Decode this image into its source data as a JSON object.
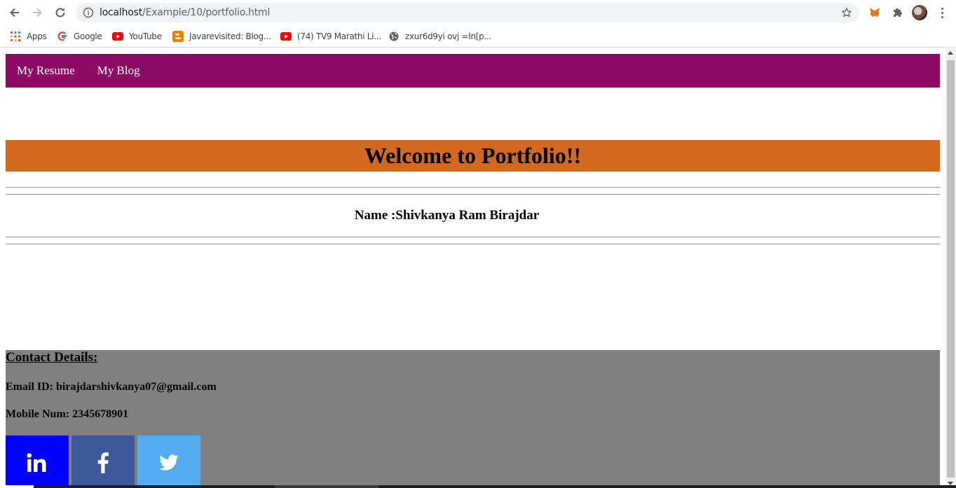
{
  "browser": {
    "url_host": "localhost",
    "url_path": "/Example/10/portfolio.html",
    "bookmarks": [
      {
        "label": "Apps",
        "icon": "apps-grid-icon"
      },
      {
        "label": "Google",
        "icon": "google-icon"
      },
      {
        "label": "YouTube",
        "icon": "youtube-icon"
      },
      {
        "label": "Javarevisited: Blog...",
        "icon": "blogger-icon"
      },
      {
        "label": "(74) TV9 Marathi Li...",
        "icon": "youtube-icon"
      },
      {
        "label": "zxur6d9yi ovj =In[p...",
        "icon": "globe-icon"
      }
    ]
  },
  "page": {
    "nav": {
      "items": [
        "My Resume",
        "My Blog"
      ]
    },
    "welcome_title": "Welcome to Portfolio!!",
    "name_line": "Name :Shivkanya Ram Birajdar",
    "contact": {
      "heading": "Contact Details:",
      "email": "Email ID: birajdarshivkanya07@gmail.com",
      "mobile": "Mobile Num: 2345678901"
    },
    "social": [
      {
        "icon": "linkedin-icon",
        "color": "#0000ff"
      },
      {
        "icon": "facebook-icon",
        "color": "#3b5998"
      },
      {
        "icon": "twitter-icon",
        "color": "#55acee"
      }
    ]
  },
  "colors": {
    "nav_bg": "#8b0a62",
    "welcome_bg": "#d2691e",
    "footer_bg": "#808080"
  }
}
